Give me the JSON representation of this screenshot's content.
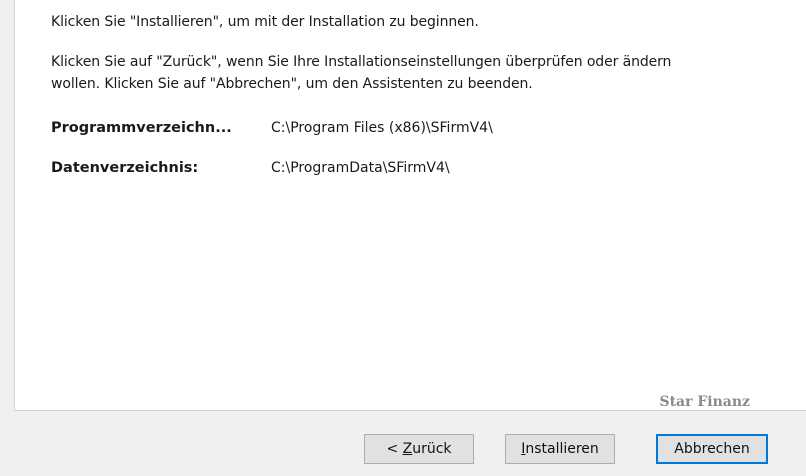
{
  "content": {
    "line_1": "Klicken Sie \"Installieren\", um mit der Installation zu beginnen.",
    "line_2": "Klicken Sie auf \"Zurück\", wenn Sie Ihre Installationseinstellungen überprüfen oder ändern",
    "line_3": "wollen. Klicken Sie auf \"Abbrechen\", um den Assistenten zu beenden.",
    "program_dir": {
      "label": "Programmverzeichn...",
      "value": "C:\\Program Files (x86)\\SFirmV4\\"
    },
    "data_dir": {
      "label": "Datenverzeichnis:",
      "value": "C:\\ProgramData\\SFirmV4\\"
    }
  },
  "footer": {
    "brand": "Star Finanz"
  },
  "buttons": {
    "back": {
      "prefix": "< ",
      "accel": "Z",
      "rest": "urück"
    },
    "install": {
      "accel": "I",
      "rest": "nstallieren"
    },
    "cancel": {
      "label": "Abbrechen"
    }
  },
  "colors": {
    "focus_border": "#0078d7",
    "panel_bg": "#ffffff",
    "window_bg": "#f0f0f0"
  }
}
